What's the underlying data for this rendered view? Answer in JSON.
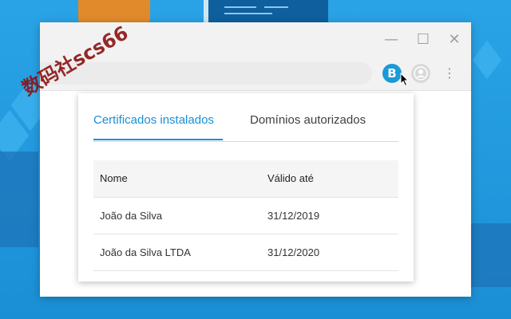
{
  "window": {
    "minimize_symbol": "—",
    "maximize_symbol": "☐",
    "close_symbol": "✕"
  },
  "toolbar": {
    "extension_letter": "B",
    "menu_symbol": "⋮"
  },
  "popup": {
    "tabs": [
      {
        "label": "Certificados instalados",
        "active": true
      },
      {
        "label": "Domínios autorizados",
        "active": false
      }
    ],
    "table": {
      "headers": [
        "Nome",
        "Válido até"
      ],
      "rows": [
        [
          "João da Silva",
          "31/12/2019"
        ],
        [
          "João da Silva LTDA",
          "31/12/2020"
        ]
      ]
    }
  },
  "watermark": "数码社scs66",
  "colors": {
    "accent": "#1a8fd6",
    "background": "#2aa3e6",
    "watermark": "#8b1212"
  },
  "icons": [
    "minimize-icon",
    "maximize-icon",
    "close-icon",
    "extension-b-icon",
    "mouse-cursor-icon",
    "profile-icon",
    "kebab-menu-icon"
  ]
}
